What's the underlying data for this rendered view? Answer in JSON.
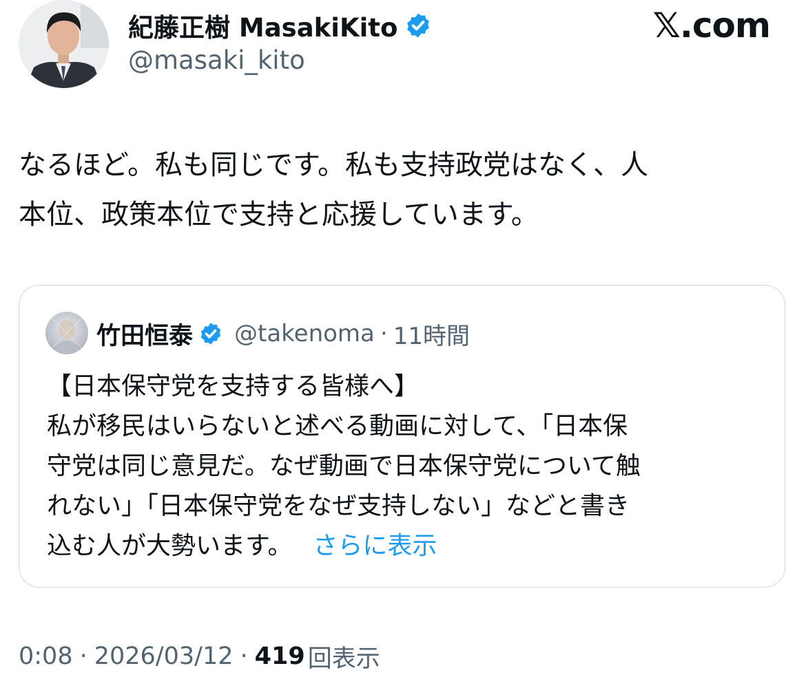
{
  "author": {
    "display_name": "紀藤正樹 MasakiKito",
    "handle": "@masaki_kito",
    "verified_icon": "verified-badge-icon"
  },
  "brand": {
    "label": "𝕏.com"
  },
  "tweet": {
    "text_lines": [
      "なるほど。私も同じです。私も支持政党はなく、人",
      "本位、政策本位で支持と応援しています。"
    ]
  },
  "quoted": {
    "display_name": "竹田恒泰",
    "handle": "@takenoma",
    "separator": "·",
    "time": "11時間",
    "body_lines": [
      "【日本保守党を支持する皆様へ】",
      "私が移民はいらないと述べる動画に対して、「日本保",
      "守党は同じ意見だ。なぜ動画で日本保守党について触",
      "れない」「日本保守党をなぜ支持しない」などと書き",
      "込む人が大勢います。"
    ],
    "show_more": "さらに表示"
  },
  "meta": {
    "time": "0:08",
    "sep1": "·",
    "date": "2026/03/12",
    "sep2": "·",
    "views_count": "419",
    "views_label": "回表示"
  },
  "colors": {
    "text": "#0f1419",
    "secondary": "#536471",
    "link": "#1d9bf0",
    "verified": "#1d9bf0",
    "border": "#cfd9de"
  }
}
